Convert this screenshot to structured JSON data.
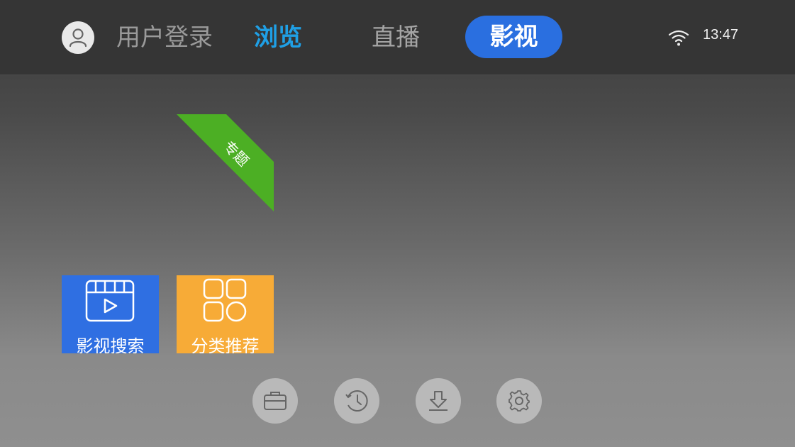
{
  "header": {
    "login_label": "用户登录",
    "tabs": [
      {
        "label": "浏览",
        "state": "highlighted"
      },
      {
        "label": "直播",
        "state": "normal"
      },
      {
        "label": "影视",
        "state": "selected"
      }
    ],
    "status": {
      "wifi_icon": "wifi-icon",
      "time": "13:47"
    }
  },
  "content": {
    "featured_badge": "专题",
    "tiles": [
      {
        "label": "影视搜索",
        "icon": "film-play-icon",
        "color": "#2f6fe2"
      },
      {
        "label": "分类推荐",
        "icon": "category-grid-icon",
        "color": "#f7ab37"
      }
    ]
  },
  "bottom_bar": {
    "buttons": [
      {
        "icon": "folder-icon"
      },
      {
        "icon": "history-clock-icon"
      },
      {
        "icon": "download-icon"
      },
      {
        "icon": "settings-gear-icon"
      }
    ]
  },
  "colors": {
    "accent_blue": "#2a6fe0",
    "browse_blue": "#1fa0e6",
    "badge_green": "#4caf24"
  }
}
